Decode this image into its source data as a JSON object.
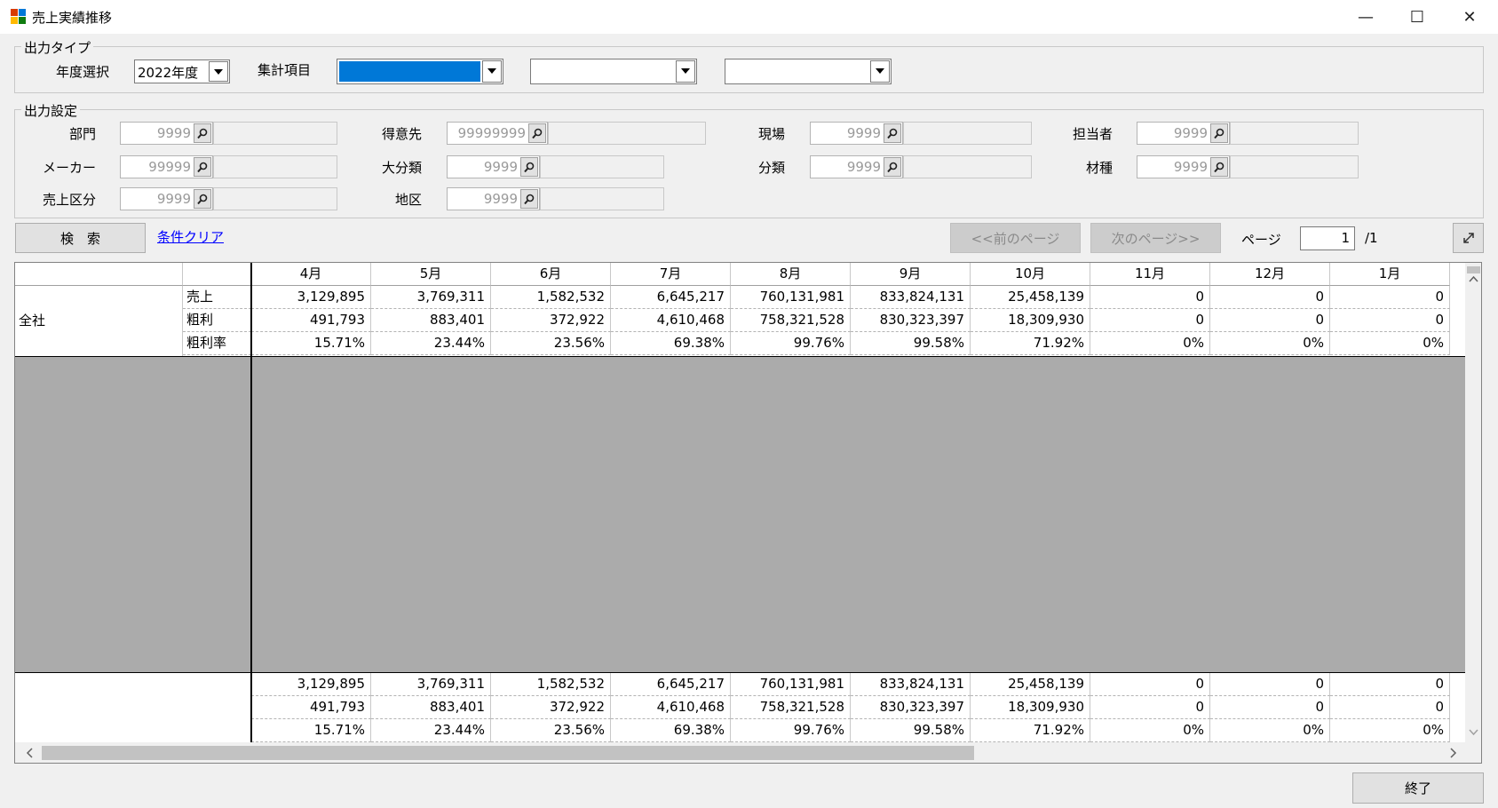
{
  "window": {
    "title": "売上実績推移",
    "minimize": "—",
    "maximize": "☐",
    "close": "✕"
  },
  "output_type": {
    "legend": "出力タイプ",
    "year_label": "年度選択",
    "year_value": "2022年度",
    "agg_label": "集計項目",
    "agg_value": "",
    "agg2_value": "",
    "agg3_value": ""
  },
  "output_settings": {
    "legend": "出力設定",
    "fields": [
      {
        "label": "部門",
        "code": "9999"
      },
      {
        "label": "得意先",
        "code": "99999999"
      },
      {
        "label": "現場",
        "code": "9999"
      },
      {
        "label": "担当者",
        "code": "9999"
      },
      {
        "label": "メーカー",
        "code": "99999"
      },
      {
        "label": "大分類",
        "code": "9999"
      },
      {
        "label": "分類",
        "code": "9999"
      },
      {
        "label": "材種",
        "code": "9999"
      },
      {
        "label": "売上区分",
        "code": "9999"
      },
      {
        "label": "地区",
        "code": "9999"
      }
    ]
  },
  "actions": {
    "search": "検　索",
    "clear": "条件クリア",
    "prev_page": "<<前のページ",
    "next_page": "次のページ>>",
    "page_label": "ページ",
    "page_value": "1",
    "page_total": "/1",
    "exit": "終了"
  },
  "grid": {
    "months": [
      "4月",
      "5月",
      "6月",
      "7月",
      "8月",
      "9月",
      "10月",
      "11月",
      "12月",
      "1月"
    ],
    "group_label": "全社",
    "row_labels": [
      "売上",
      "粗利",
      "粗利率"
    ],
    "rows": [
      [
        "3,129,895",
        "3,769,311",
        "1,582,532",
        "6,645,217",
        "760,131,981",
        "833,824,131",
        "25,458,139",
        "0",
        "0",
        "0"
      ],
      [
        "491,793",
        "883,401",
        "372,922",
        "4,610,468",
        "758,321,528",
        "830,323,397",
        "18,309,930",
        "0",
        "0",
        "0"
      ],
      [
        "15.71%",
        "23.44%",
        "23.56%",
        "69.38%",
        "99.76%",
        "99.58%",
        "71.92%",
        "0%",
        "0%",
        "0%"
      ]
    ],
    "totals": [
      [
        "3,129,895",
        "3,769,311",
        "1,582,532",
        "6,645,217",
        "760,131,981",
        "833,824,131",
        "25,458,139",
        "0",
        "0",
        "0"
      ],
      [
        "491,793",
        "883,401",
        "372,922",
        "4,610,468",
        "758,321,528",
        "830,323,397",
        "18,309,930",
        "0",
        "0",
        "0"
      ],
      [
        "15.71%",
        "23.44%",
        "23.56%",
        "69.38%",
        "99.76%",
        "99.58%",
        "71.92%",
        "0%",
        "0%",
        "0%"
      ]
    ]
  },
  "icons": {
    "app": "app-window-icon",
    "lookup": "magnifier-icon",
    "expand": "expand-icon"
  },
  "colors": {
    "selection": "#0078d7",
    "link": "#0000ff"
  }
}
